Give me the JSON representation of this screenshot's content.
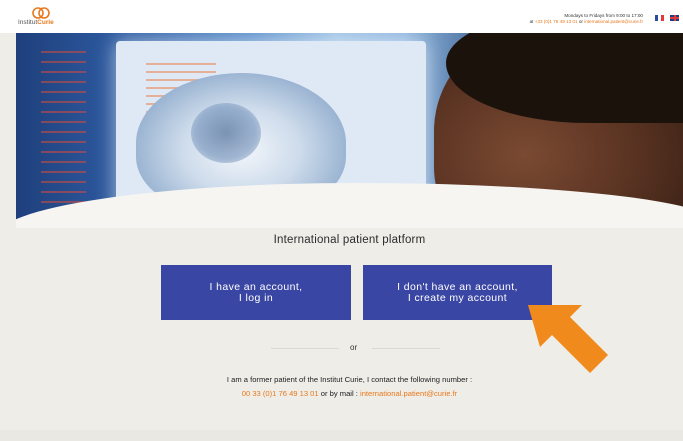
{
  "header": {
    "logo": {
      "prefix": "Institut",
      "brand": "Curie"
    },
    "hours": "Mondays to Fridays from 9:00 to 17:00",
    "contact_at": "at",
    "phone": "+33 (0)1 76 49 13 01",
    "contact_or": "or",
    "email": "international.patient@curie.fr",
    "languages": [
      "FR",
      "EN"
    ]
  },
  "main": {
    "title": "International patient platform",
    "login_button": {
      "line1": "I have an account,",
      "line2": "I log in"
    },
    "create_button": {
      "line1": "I don't have an account,",
      "line2": "I create my account"
    },
    "or_label": "or",
    "former_patient_text": "I am a former patient of the Institut Curie, I contact the following number :",
    "former_phone": "00 33 (0)1 76 49 13 01",
    "former_or_mail": "or by mail :",
    "former_email": "international.patient@curie.fr"
  },
  "colors": {
    "primary_button": "#3a46a3",
    "accent_orange": "#e8791e",
    "arrow_orange": "#f08a1d"
  },
  "icons": [
    "pointer-arrow-icon",
    "flag-fr-icon",
    "flag-uk-icon"
  ]
}
